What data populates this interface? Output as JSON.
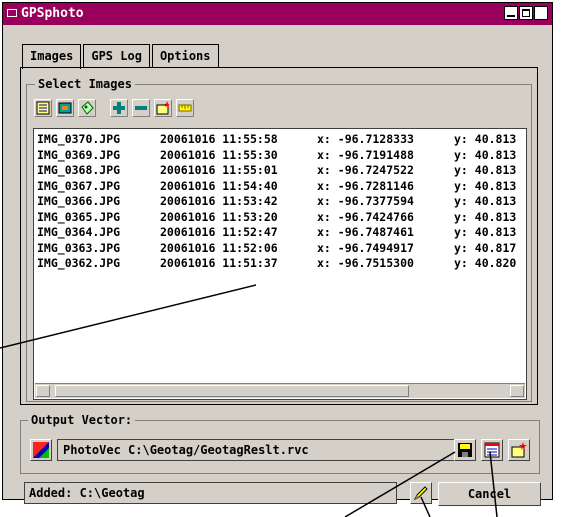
{
  "window": {
    "title": "GPSphoto"
  },
  "tabs": [
    {
      "label": "Images",
      "active": true
    },
    {
      "label": "GPS Log",
      "active": false
    },
    {
      "label": "Options",
      "active": false
    }
  ],
  "select_images": {
    "legend": "Select Images",
    "toolbar_icons": [
      "select-files-icon",
      "image-icon",
      "tag-icon",
      "add-icon",
      "remove-icon",
      "new-file-icon",
      "ruler-icon"
    ],
    "rows": [
      {
        "file": "IMG_0370.JPG",
        "datetime": "20061016 11:55:58",
        "x": "x: -96.7128333",
        "y": "y: 40.813"
      },
      {
        "file": "IMG_0369.JPG",
        "datetime": "20061016 11:55:30",
        "x": "x: -96.7191488",
        "y": "y: 40.813"
      },
      {
        "file": "IMG_0368.JPG",
        "datetime": "20061016 11:55:01",
        "x": "x: -96.7247522",
        "y": "y: 40.813"
      },
      {
        "file": "IMG_0367.JPG",
        "datetime": "20061016 11:54:40",
        "x": "x: -96.7281146",
        "y": "y: 40.813"
      },
      {
        "file": "IMG_0366.JPG",
        "datetime": "20061016 11:53:42",
        "x": "x: -96.7377594",
        "y": "y: 40.813"
      },
      {
        "file": "IMG_0365.JPG",
        "datetime": "20061016 11:53:20",
        "x": "x: -96.7424766",
        "y": "y: 40.813"
      },
      {
        "file": "IMG_0364.JPG",
        "datetime": "20061016 11:52:47",
        "x": "x: -96.7487461",
        "y": "y: 40.813"
      },
      {
        "file": "IMG_0363.JPG",
        "datetime": "20061016 11:52:06",
        "x": "x: -96.7494917",
        "y": "y: 40.817"
      },
      {
        "file": "IMG_0362.JPG",
        "datetime": "20061016 11:51:37",
        "x": "x: -96.7515300",
        "y": "y: 40.820"
      }
    ]
  },
  "output": {
    "legend": "Output Vector:",
    "value": "PhotoVec C:\\Geotag/GeotagReslt.rvc"
  },
  "status": {
    "text": "Added: C:\\Geotag"
  },
  "buttons": {
    "cancel": "Cancel"
  },
  "colors": {
    "titlebar": "#99005c",
    "window": "#d4d0c8"
  }
}
